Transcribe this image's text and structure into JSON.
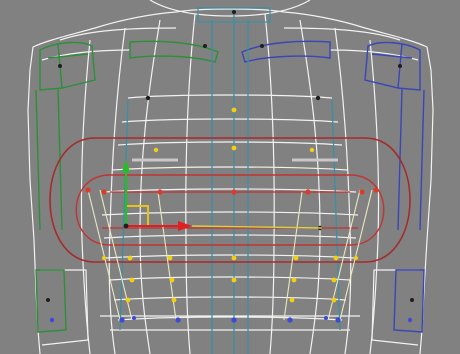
{
  "viewport": {
    "background_color": "#818181",
    "mesh_color": "#f2f2f2",
    "colors": {
      "left_limb": "#2e8f3a",
      "right_limb": "#3a46b8",
      "guide_lines": "#3a8fa4",
      "oval_outer": "#a52a2a",
      "oval_inner": "#c03434",
      "point_yellow": "#f0d010",
      "point_red": "#dc3a2a",
      "point_blue": "#3b4bd6",
      "point_black": "#1e1e1e",
      "gizmo_x": "#e02020",
      "gizmo_y": "#22c022",
      "gizmo_plane": "#e6c21a"
    },
    "icons": [
      "move-gizmo-icon",
      "pivot-point-icon"
    ]
  }
}
